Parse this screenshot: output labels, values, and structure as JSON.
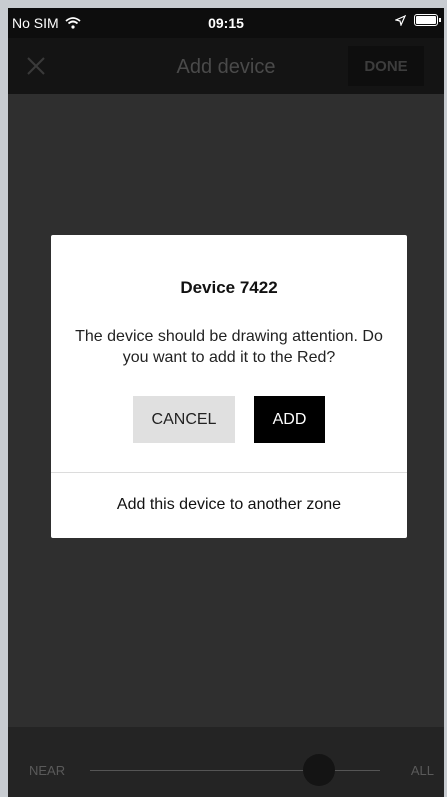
{
  "status_bar": {
    "carrier": "No SIM",
    "time": "09:15",
    "icons": [
      "wifi-icon",
      "location-arrow-icon",
      "battery-icon"
    ]
  },
  "nav_bar": {
    "title": "Add device",
    "done_label": "DONE",
    "close_icon": "close-icon"
  },
  "dialog": {
    "title": "Device 7422",
    "message": "The device should be drawing attention. Do you want to add it to the Red?",
    "cancel_label": "CANCEL",
    "add_label": "ADD",
    "zone_link": "Add this device to another zone"
  },
  "range_slider": {
    "min_label": "NEAR",
    "max_label": "ALL",
    "value_fraction": 0.79
  },
  "colors": {
    "overlay_bg": "#2f2f2f",
    "dialog_bg": "#ffffff",
    "add_button_bg": "#000000",
    "cancel_button_bg": "#e0e0e0"
  }
}
